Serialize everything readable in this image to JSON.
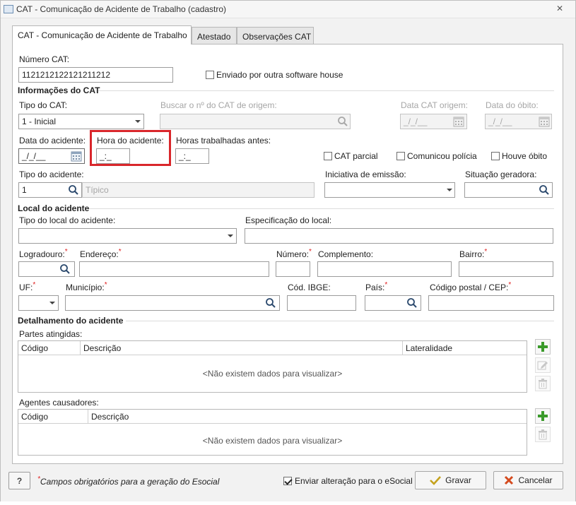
{
  "window": {
    "title": "CAT - Comunicação de Acidente de Trabalho (cadastro)",
    "close_glyph": "✕"
  },
  "tabs": [
    {
      "label": "CAT - Comunicação de Acidente de Trabalho"
    },
    {
      "label": "Atestado"
    },
    {
      "label": "Observações CAT"
    }
  ],
  "numero_cat": {
    "label": "Número CAT:",
    "value": "1121212122121211212"
  },
  "enviado_outra": {
    "label": "Enviado por outra software house",
    "checked": false
  },
  "sec_info": "Informações do CAT",
  "tipo_cat": {
    "label": "Tipo do CAT:",
    "value": "1 - Inicial"
  },
  "buscar_origem": {
    "label": "Buscar o nº do CAT de origem:",
    "value": ""
  },
  "data_cat_origem": {
    "label": "Data CAT origem:",
    "value": "_/_/__"
  },
  "data_obito": {
    "label": "Data do óbito:",
    "value": "_/_/__"
  },
  "data_acidente": {
    "label": "Data do acidente:",
    "value": "_/_/__"
  },
  "hora_acidente": {
    "label": "Hora do acidente:",
    "value": "_:_"
  },
  "horas_trab": {
    "label": "Horas trabalhadas antes:",
    "value": "_:_"
  },
  "cat_parcial": {
    "label": "CAT parcial",
    "checked": false
  },
  "comunicou_policia": {
    "label": "Comunicou polícia",
    "checked": false
  },
  "houve_obito": {
    "label": "Houve óbito",
    "checked": false
  },
  "tipo_acidente": {
    "label": "Tipo do acidente:",
    "code": "1",
    "desc": "Típico"
  },
  "iniciativa": {
    "label": "Iniciativa de emissão:",
    "value": ""
  },
  "situacao": {
    "label": "Situação geradora:",
    "value": ""
  },
  "sec_local": "Local do acidente",
  "tipo_local": {
    "label": "Tipo do local do acidente:"
  },
  "especificacao": {
    "label": "Especificação do local:"
  },
  "logradouro": {
    "label": "Logradouro:",
    "req": "*"
  },
  "endereco": {
    "label": "Endereço:",
    "req": "*"
  },
  "numero": {
    "label": "Número:",
    "req": "*"
  },
  "complemento": {
    "label": "Complemento:"
  },
  "bairro": {
    "label": "Bairro:",
    "req": "*"
  },
  "uf": {
    "label": "UF:",
    "req": "*"
  },
  "municipio": {
    "label": "Município:",
    "req": "*"
  },
  "cod_ibge": {
    "label": "Cód. IBGE:"
  },
  "pais": {
    "label": "País:",
    "req": "*"
  },
  "cep": {
    "label": "Código postal / CEP:",
    "req": "*"
  },
  "sec_detalhamento": "Detalhamento do acidente",
  "partes": {
    "label": "Partes atingidas:",
    "columns": [
      "Código",
      "Descrição",
      "Lateralidade"
    ],
    "empty": "<Não existem dados para visualizar>"
  },
  "agentes": {
    "label": "Agentes causadores:",
    "columns": [
      "Código",
      "Descrição"
    ],
    "empty": "<Não existem dados para visualizar>"
  },
  "footer": {
    "help": "?",
    "note_star": "*",
    "note": "Campos obrigatórios para a geração do Esocial",
    "enviar_esocial": {
      "label": "Enviar alteração para o eSocial",
      "checked": true
    },
    "gravar": "Gravar",
    "cancelar": "Cancelar"
  },
  "colors": {
    "accent_red": "#d9262b",
    "add_green": "#3a9a2a",
    "required": "#e02020"
  },
  "icons": [
    "app-icon",
    "close-icon",
    "search-icon",
    "calendar-icon",
    "add-icon",
    "edit-icon",
    "trash-icon",
    "check-icon",
    "cancel-x-icon",
    "help-icon"
  ]
}
